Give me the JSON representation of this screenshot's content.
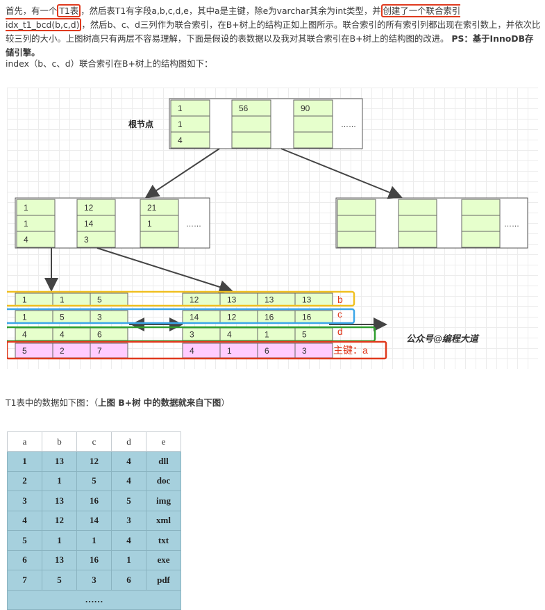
{
  "intro": {
    "p1": "首先，有一个",
    "t1_label": "T1表",
    "p2": "，然后表T1有字段a,b,c,d,e，其中a是主键，除e为varchar其余为int类型，并",
    "index_label": "创建了一个联合索引idx_t1_bcd(b,c,d)",
    "p3": "，然后b、c、d三列作为联合索引，在B+树上的结构正如上图所示。联合索引的所有索引列都出现在索引数上，并依次比较三列的大小。上图树高只有两层不容易理解，下面是假设的表数据以及我对其联合索引在B+树上的结构图的改进。 ",
    "ps": "PS：基于InnoDB存储引擎。"
  },
  "structure_caption": "index（b、c、d）联合索引在B+树上的结构图如下：",
  "diagram": {
    "root_label": "根节点",
    "root": [
      [
        "1",
        "1",
        "4"
      ],
      [
        "56",
        "",
        ""
      ],
      [
        "90",
        "",
        ""
      ]
    ],
    "ellipsis": "……",
    "left_child": [
      [
        "1",
        "1",
        "4"
      ],
      [
        "12",
        "14",
        "3"
      ],
      [
        "21",
        "1",
        ""
      ]
    ],
    "leaf_rows": {
      "b": [
        "1",
        "1",
        "5",
        "12",
        "13",
        "13",
        "13"
      ],
      "c": [
        "1",
        "5",
        "3",
        "14",
        "12",
        "16",
        "16"
      ],
      "d": [
        "4",
        "4",
        "6",
        "3",
        "4",
        "1",
        "5"
      ],
      "a": [
        "5",
        "2",
        "7",
        "4",
        "1",
        "6",
        "3"
      ]
    },
    "row_labels": {
      "b": "b",
      "c": "c",
      "d": "d",
      "a": "主键：a"
    },
    "watermark": "公众号@编程大道",
    "colors": {
      "green": "#e6ffcc",
      "pink": "#ffccff",
      "yellow": "#f0c020",
      "blue": "#3ba6e8",
      "dgreen": "#2e9e2e",
      "red": "#e03a1e"
    }
  },
  "table_caption_prefix": "T1表中的数据如下图：（",
  "table_caption_bold": "上图 B+树 中的数据就来自下图",
  "table_caption_suffix": "）",
  "table": {
    "headers": [
      "a",
      "b",
      "c",
      "d",
      "e"
    ],
    "rows": [
      [
        "1",
        "13",
        "12",
        "4",
        "dll"
      ],
      [
        "2",
        "1",
        "5",
        "4",
        "doc"
      ],
      [
        "3",
        "13",
        "16",
        "5",
        "img"
      ],
      [
        "4",
        "12",
        "14",
        "3",
        "xml"
      ],
      [
        "5",
        "1",
        "1",
        "4",
        "txt"
      ],
      [
        "6",
        "13",
        "16",
        "1",
        "exe"
      ],
      [
        "7",
        "5",
        "3",
        "6",
        "pdf"
      ]
    ],
    "footer": "……"
  }
}
